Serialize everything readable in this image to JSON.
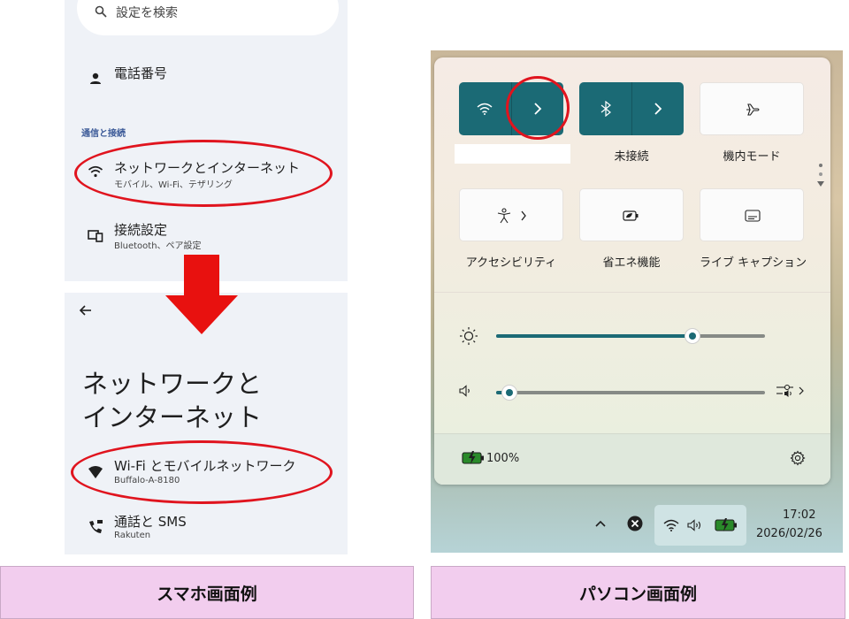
{
  "phone": {
    "search_text": "設定を検索",
    "phone_number_label": "電話番号",
    "section_header": "通信と接続",
    "network_item": {
      "title": "ネットワークとインターネット",
      "subtitle": "モバイル、Wi-Fi、テザリング"
    },
    "connection_item": {
      "title": "接続設定",
      "subtitle": "Bluetooth、ペア設定"
    },
    "page_title_line1": "ネットワークと",
    "page_title_line2": "インターネット",
    "wifi_item": {
      "title": "Wi-Fi とモバイルネットワーク",
      "subtitle": "Buffalo-A-8180"
    },
    "calls_item": {
      "title": "通話と SMS",
      "subtitle": "Rakuten"
    }
  },
  "windows": {
    "tiles": [
      {
        "label": "",
        "icon": "wifi-icon",
        "state": "on"
      },
      {
        "label": "未接続",
        "icon": "bluetooth-icon",
        "state": "on"
      },
      {
        "label": "機内モード",
        "icon": "airplane-icon",
        "state": "off"
      },
      {
        "label": "アクセシビリティ",
        "icon": "accessibility-icon",
        "state": "off"
      },
      {
        "label": "省エネ機能",
        "icon": "energy-saver-icon",
        "state": "off"
      },
      {
        "label": "ライブ キャプション",
        "icon": "live-caption-icon",
        "state": "off"
      }
    ],
    "brightness_level": 0.73,
    "volume_level": 0.05,
    "battery_text": "100%",
    "clock_time": "17:02",
    "clock_date": "2026/02/26"
  },
  "captions": {
    "left": "スマホ画面例",
    "right": "パソコン画面例"
  },
  "colors": {
    "accent": "#1b6a75",
    "highlight_oval": "#e0141e",
    "caption_bg": "#f2cdee",
    "arrow": "#e8110f"
  }
}
